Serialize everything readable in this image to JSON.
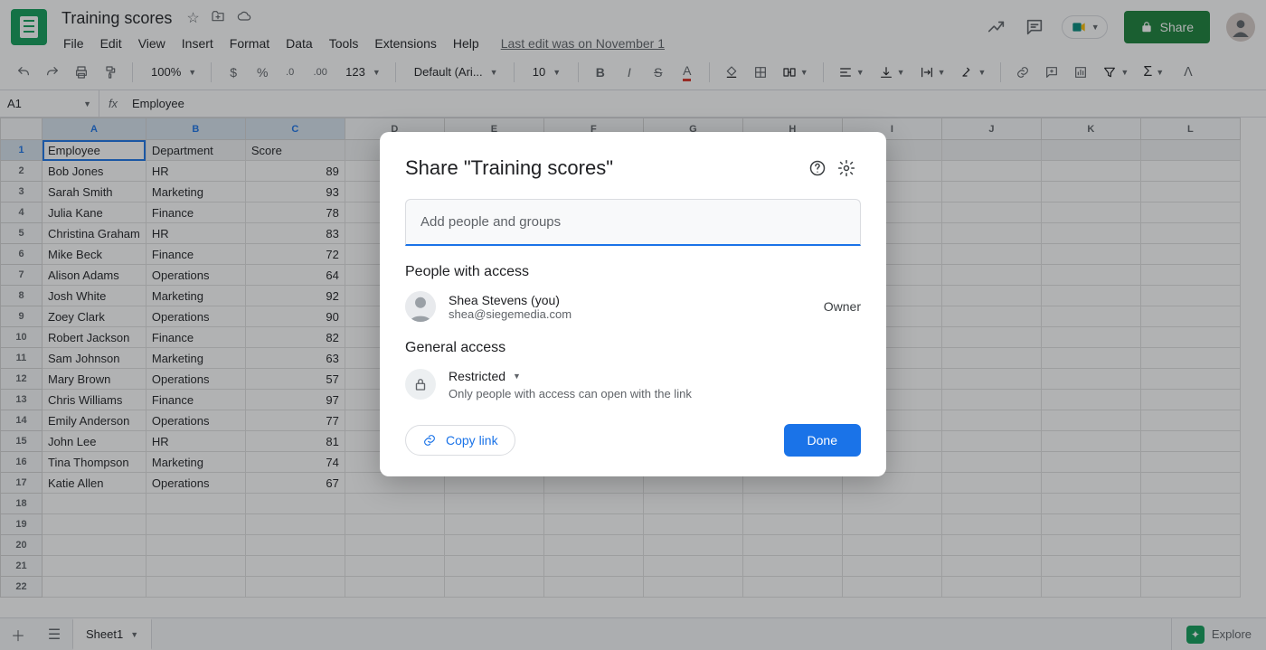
{
  "doc": {
    "title": "Training scores"
  },
  "menus": [
    "File",
    "Edit",
    "View",
    "Insert",
    "Format",
    "Data",
    "Tools",
    "Extensions",
    "Help"
  ],
  "last_edit": "Last edit was on November 1",
  "share_btn": "Share",
  "toolbar": {
    "zoom": "100%",
    "font": "Default (Ari...",
    "size": "10"
  },
  "name_box": "A1",
  "formula": "Employee",
  "columns": [
    "A",
    "B",
    "C",
    "D",
    "E",
    "F",
    "G",
    "H",
    "I",
    "J",
    "K",
    "L"
  ],
  "rows": 22,
  "headers": [
    "Employee",
    "Department",
    "Score"
  ],
  "data_rows": [
    [
      "Bob Jones",
      "HR",
      89
    ],
    [
      "Sarah Smith",
      "Marketing",
      93
    ],
    [
      "Julia Kane",
      "Finance",
      78
    ],
    [
      "Christina Graham",
      "HR",
      83
    ],
    [
      "Mike Beck",
      "Finance",
      72
    ],
    [
      "Alison Adams",
      "Operations",
      64
    ],
    [
      "Josh White",
      "Marketing",
      92
    ],
    [
      "Zoey Clark",
      "Operations",
      90
    ],
    [
      "Robert Jackson",
      "Finance",
      82
    ],
    [
      "Sam Johnson",
      "Marketing",
      63
    ],
    [
      "Mary Brown",
      "Operations",
      57
    ],
    [
      "Chris Williams",
      "Finance",
      97
    ],
    [
      "Emily Anderson",
      "Operations",
      77
    ],
    [
      "John Lee",
      "HR",
      81
    ],
    [
      "Tina Thompson",
      "Marketing",
      74
    ],
    [
      "Katie Allen",
      "Operations",
      67
    ]
  ],
  "sheet_tab": "Sheet1",
  "explore": "Explore",
  "dialog": {
    "title": "Share \"Training scores\"",
    "add_placeholder": "Add people and groups",
    "people_section": "People with access",
    "person_name": "Shea Stevens (you)",
    "person_email": "shea@siegemedia.com",
    "person_role": "Owner",
    "general_section": "General access",
    "restriction": "Restricted",
    "restriction_desc": "Only people with access can open with the link",
    "copy_link": "Copy link",
    "done": "Done"
  }
}
